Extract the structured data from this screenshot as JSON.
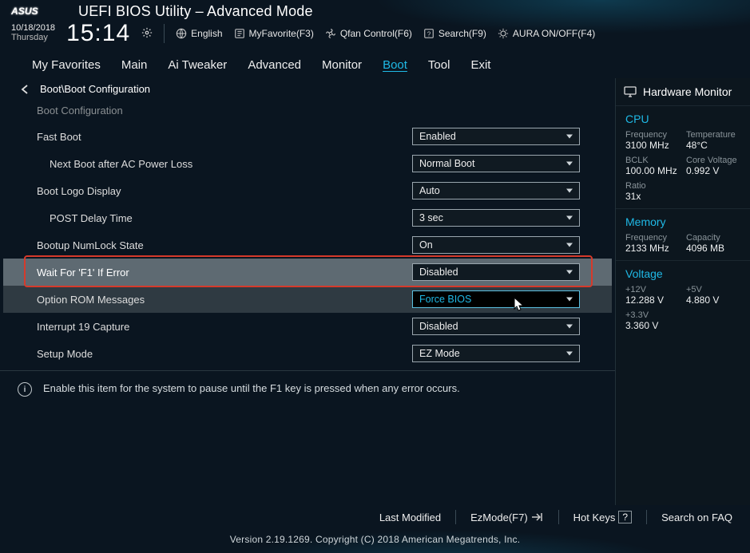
{
  "header": {
    "title": "UEFI BIOS Utility – Advanced Mode",
    "date": "10/18/2018",
    "day": "Thursday",
    "time": "15:14",
    "lang": "English",
    "tools": {
      "fav": "MyFavorite(F3)",
      "qfan": "Qfan Control(F6)",
      "search": "Search(F9)",
      "aura": "AURA ON/OFF(F4)"
    }
  },
  "menu": [
    "My Favorites",
    "Main",
    "Ai Tweaker",
    "Advanced",
    "Monitor",
    "Boot",
    "Tool",
    "Exit"
  ],
  "active_menu": "Boot",
  "breadcrumb": "Boot\\Boot Configuration",
  "section_label": "Boot Configuration",
  "settings": [
    {
      "name": "fast-boot",
      "label": "Fast Boot",
      "value": "Enabled",
      "indent": false,
      "state": "normal"
    },
    {
      "name": "next-boot-ac",
      "label": "Next Boot after AC Power Loss",
      "value": "Normal Boot",
      "indent": true,
      "state": "normal"
    },
    {
      "name": "boot-logo",
      "label": "Boot Logo Display",
      "value": "Auto",
      "indent": false,
      "state": "normal"
    },
    {
      "name": "post-delay",
      "label": "POST Delay Time",
      "value": "3 sec",
      "indent": true,
      "state": "normal"
    },
    {
      "name": "numlock",
      "label": "Bootup NumLock State",
      "value": "On",
      "indent": false,
      "state": "normal"
    },
    {
      "name": "wait-f1",
      "label": "Wait For 'F1' If Error",
      "value": "Disabled",
      "indent": false,
      "state": "highlight"
    },
    {
      "name": "option-rom",
      "label": "Option ROM Messages",
      "value": "Force BIOS",
      "indent": false,
      "state": "hover"
    },
    {
      "name": "int19",
      "label": "Interrupt 19 Capture",
      "value": "Disabled",
      "indent": false,
      "state": "normal"
    },
    {
      "name": "setup-mode",
      "label": "Setup Mode",
      "value": "EZ Mode",
      "indent": false,
      "state": "normal"
    }
  ],
  "help_text": "Enable this item for the system to pause until the F1 key is pressed when any error occurs.",
  "sidebar": {
    "title": "Hardware Monitor",
    "groups": [
      {
        "title": "CPU",
        "pairs": [
          [
            "Frequency",
            "3100 MHz",
            "Temperature",
            "48°C"
          ],
          [
            "BCLK",
            "100.00 MHz",
            "Core Voltage",
            "0.992 V"
          ],
          [
            "Ratio",
            "31x",
            "",
            ""
          ]
        ]
      },
      {
        "title": "Memory",
        "pairs": [
          [
            "Frequency",
            "2133 MHz",
            "Capacity",
            "4096 MB"
          ]
        ]
      },
      {
        "title": "Voltage",
        "pairs": [
          [
            "+12V",
            "12.288 V",
            "+5V",
            "4.880 V"
          ],
          [
            "+3.3V",
            "3.360 V",
            "",
            ""
          ]
        ]
      }
    ]
  },
  "footer": {
    "last_modified": "Last Modified",
    "ezmode": "EzMode(F7)",
    "hotkeys": "Hot Keys",
    "hotkeys_box": "?",
    "faq": "Search on FAQ"
  },
  "version": "Version 2.19.1269. Copyright (C) 2018 American Megatrends, Inc."
}
